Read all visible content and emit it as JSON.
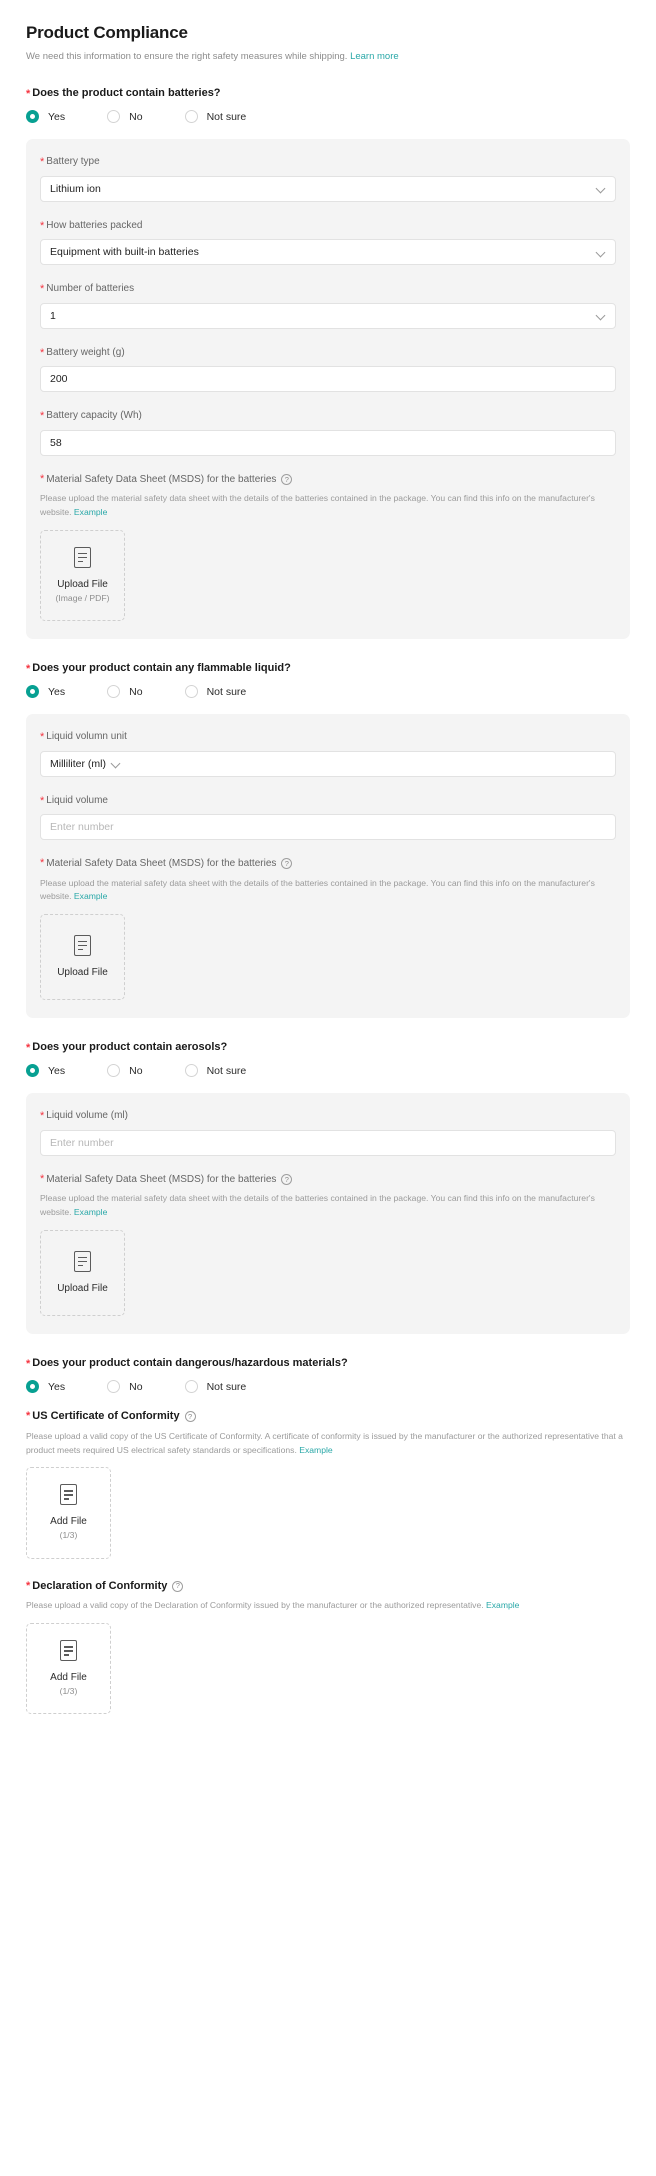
{
  "header": {
    "title": "Product Compliance",
    "subtitle": "We need this information to ensure the right safety measures while shipping.",
    "learn_more": "Learn more"
  },
  "radio_options": {
    "yes": "Yes",
    "no": "No",
    "not_sure": "Not sure"
  },
  "icons": {
    "help": "?",
    "chevron_down": "chevron-down-icon",
    "document": "document-icon"
  },
  "colors": {
    "accent": "#07a092",
    "link": "#2aa8a8",
    "required_asterisk": "#f5333f",
    "panel_bg": "#f4f4f4"
  },
  "sections": {
    "batteries": {
      "question": "Does the product contain batteries?",
      "selected": "Yes",
      "fields": {
        "battery_type": {
          "label": "Battery type",
          "value": "Lithium ion"
        },
        "how_packed": {
          "label": "How batteries packed",
          "value": "Equipment with built-in batteries"
        },
        "number": {
          "label": "Number of batteries",
          "value": "1"
        },
        "weight": {
          "label": "Battery weight (g)",
          "value": "200"
        },
        "capacity": {
          "label": "Battery capacity (Wh)",
          "value": "58"
        }
      },
      "msds": {
        "label": "Material Safety Data Sheet (MSDS) for the batteries",
        "help": "Please upload the material safety data sheet with the details of the batteries contained in the package. You can find this info on the manufacturer's website.",
        "example_link": "Example",
        "upload_main": "Upload File",
        "upload_sub": "(Image / PDF)"
      }
    },
    "flammable": {
      "question": "Does your product contain any flammable liquid?",
      "selected": "Yes",
      "fields": {
        "unit": {
          "label": "Liquid volumn unit",
          "value": "Milliliter (ml)"
        },
        "volume": {
          "label": "Liquid volume",
          "placeholder": "Enter number",
          "value": ""
        }
      },
      "msds": {
        "label": "Material Safety Data Sheet (MSDS) for the batteries",
        "help": "Please upload the material safety data sheet with the details of the batteries contained in the package. You can find this info on the manufacturer's website.",
        "example_link": "Example",
        "upload_main": "Upload File"
      }
    },
    "aerosols": {
      "question": "Does your product contain aerosols?",
      "selected": "Yes",
      "fields": {
        "volume": {
          "label": "Liquid volume (ml)",
          "placeholder": "Enter number",
          "value": ""
        }
      },
      "msds": {
        "label": "Material Safety Data Sheet (MSDS) for the batteries",
        "help": "Please upload the material safety data sheet with the details of the batteries contained in the package. You can find this info on the manufacturer's website.",
        "example_link": "Example",
        "upload_main": "Upload File"
      }
    },
    "hazardous": {
      "question": "Does your product contain dangerous/hazardous materials?",
      "selected": "Yes"
    },
    "us_certificate": {
      "label": "US Certificate of Conformity",
      "help": "Please upload a valid copy of the US Certificate of Conformity. A certificate of conformity is issued by the manufacturer or the authorized representative that a product meets required US electrical safety standards or specifications.",
      "example_link": "Example",
      "upload_main": "Add File",
      "upload_sub": "(1/3)"
    },
    "declaration": {
      "label": "Declaration of Conformity",
      "help": "Please upload a valid copy of the Declaration of Conformity issued by the manufacturer or the authorized representative.",
      "example_link": "Example",
      "upload_main": "Add File",
      "upload_sub": "(1/3)"
    }
  }
}
